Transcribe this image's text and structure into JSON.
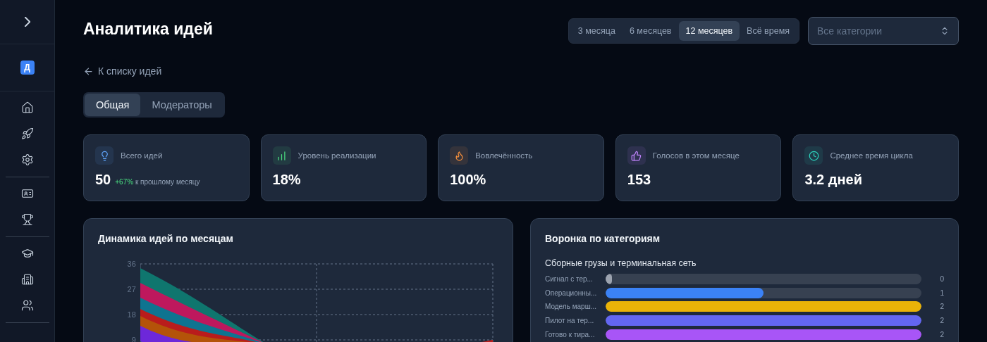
{
  "sidebar": {
    "avatar": "Д"
  },
  "page": {
    "title": "Аналитика идей",
    "back_link": "К списку идей"
  },
  "periods": [
    {
      "label": "3 месяца",
      "selected": false
    },
    {
      "label": "6 месяцев",
      "selected": false
    },
    {
      "label": "12 месяцев",
      "selected": true
    },
    {
      "label": "Всё время",
      "selected": false
    }
  ],
  "category_select": {
    "placeholder": "Все категории"
  },
  "tabs": [
    {
      "label": "Общая",
      "selected": true
    },
    {
      "label": "Модераторы",
      "selected": false
    }
  ],
  "stats": [
    {
      "kind": "ideas",
      "color": "#60a5fa",
      "label": "Всего идей",
      "value": "50",
      "delta": "+67%",
      "delta_note": "к прошлому месяцу"
    },
    {
      "kind": "rate",
      "color": "#4ade80",
      "label": "Уровень реализации",
      "value": "18%"
    },
    {
      "kind": "engagement",
      "color": "#fb923c",
      "label": "Вовлечённость",
      "value": "100%"
    },
    {
      "kind": "votes",
      "color": "#c084fc",
      "label": "Голосов в этом месяце",
      "value": "153"
    },
    {
      "kind": "cycle",
      "color": "#2dd4bf",
      "label": "Среднее время цикла",
      "value": "3.2 дней"
    }
  ],
  "dynamics": {
    "title": "Динамика идей по месяцам",
    "y_ticks": [
      "36",
      "27",
      "18",
      "9"
    ]
  },
  "funnel": {
    "title": "Воронка по категориям",
    "group": "Сборные грузы и терминальная сеть",
    "rows": [
      {
        "label": "Сигнал с тер...",
        "value": "0",
        "level": 0.02,
        "color": "#9ca3af"
      },
      {
        "label": "Операционны...",
        "value": "1",
        "level": 0.5,
        "color": "#3b82f6"
      },
      {
        "label": "Модель марш...",
        "value": "2",
        "level": 1,
        "color": "#eab308"
      },
      {
        "label": "Пилот на тер...",
        "value": "2",
        "level": 1,
        "color": "#6366f1"
      },
      {
        "label": "Готово к тира...",
        "value": "2",
        "level": 1,
        "color": "#a855f7"
      }
    ]
  }
}
